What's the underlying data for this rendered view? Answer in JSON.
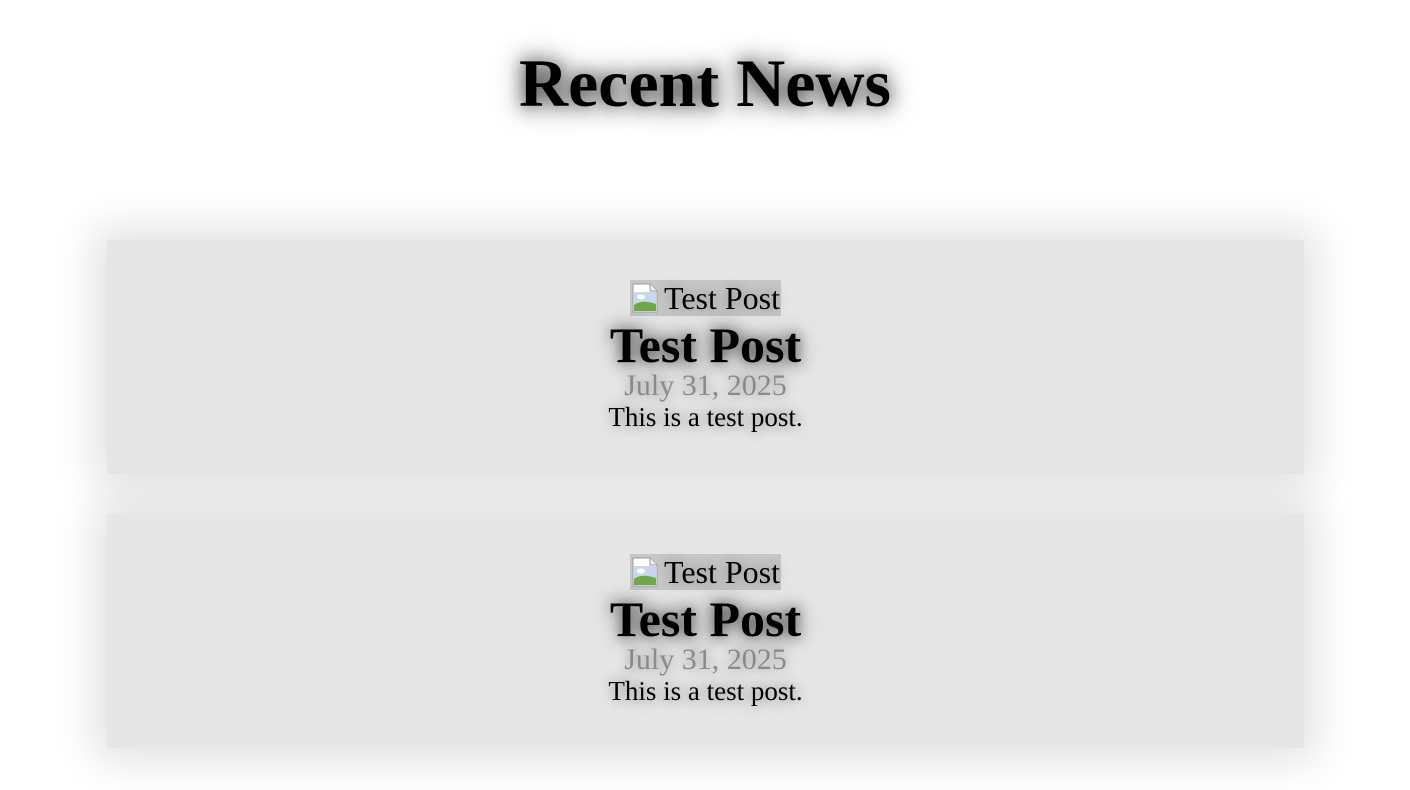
{
  "header": {
    "title": "Recent News"
  },
  "posts": [
    {
      "image_alt": "Test Post",
      "title": "Test Post",
      "date": "July 31, 2025",
      "excerpt": "This is a test post."
    },
    {
      "image_alt": "Test Post",
      "title": "Test Post",
      "date": "July 31, 2025",
      "excerpt": "This is a test post."
    }
  ],
  "icons": {
    "broken_image": "broken-image-icon"
  },
  "colors": {
    "card_background": "#e6e6e6",
    "date_text": "#8a8a8a",
    "image_placeholder": "#c6c6c6"
  }
}
